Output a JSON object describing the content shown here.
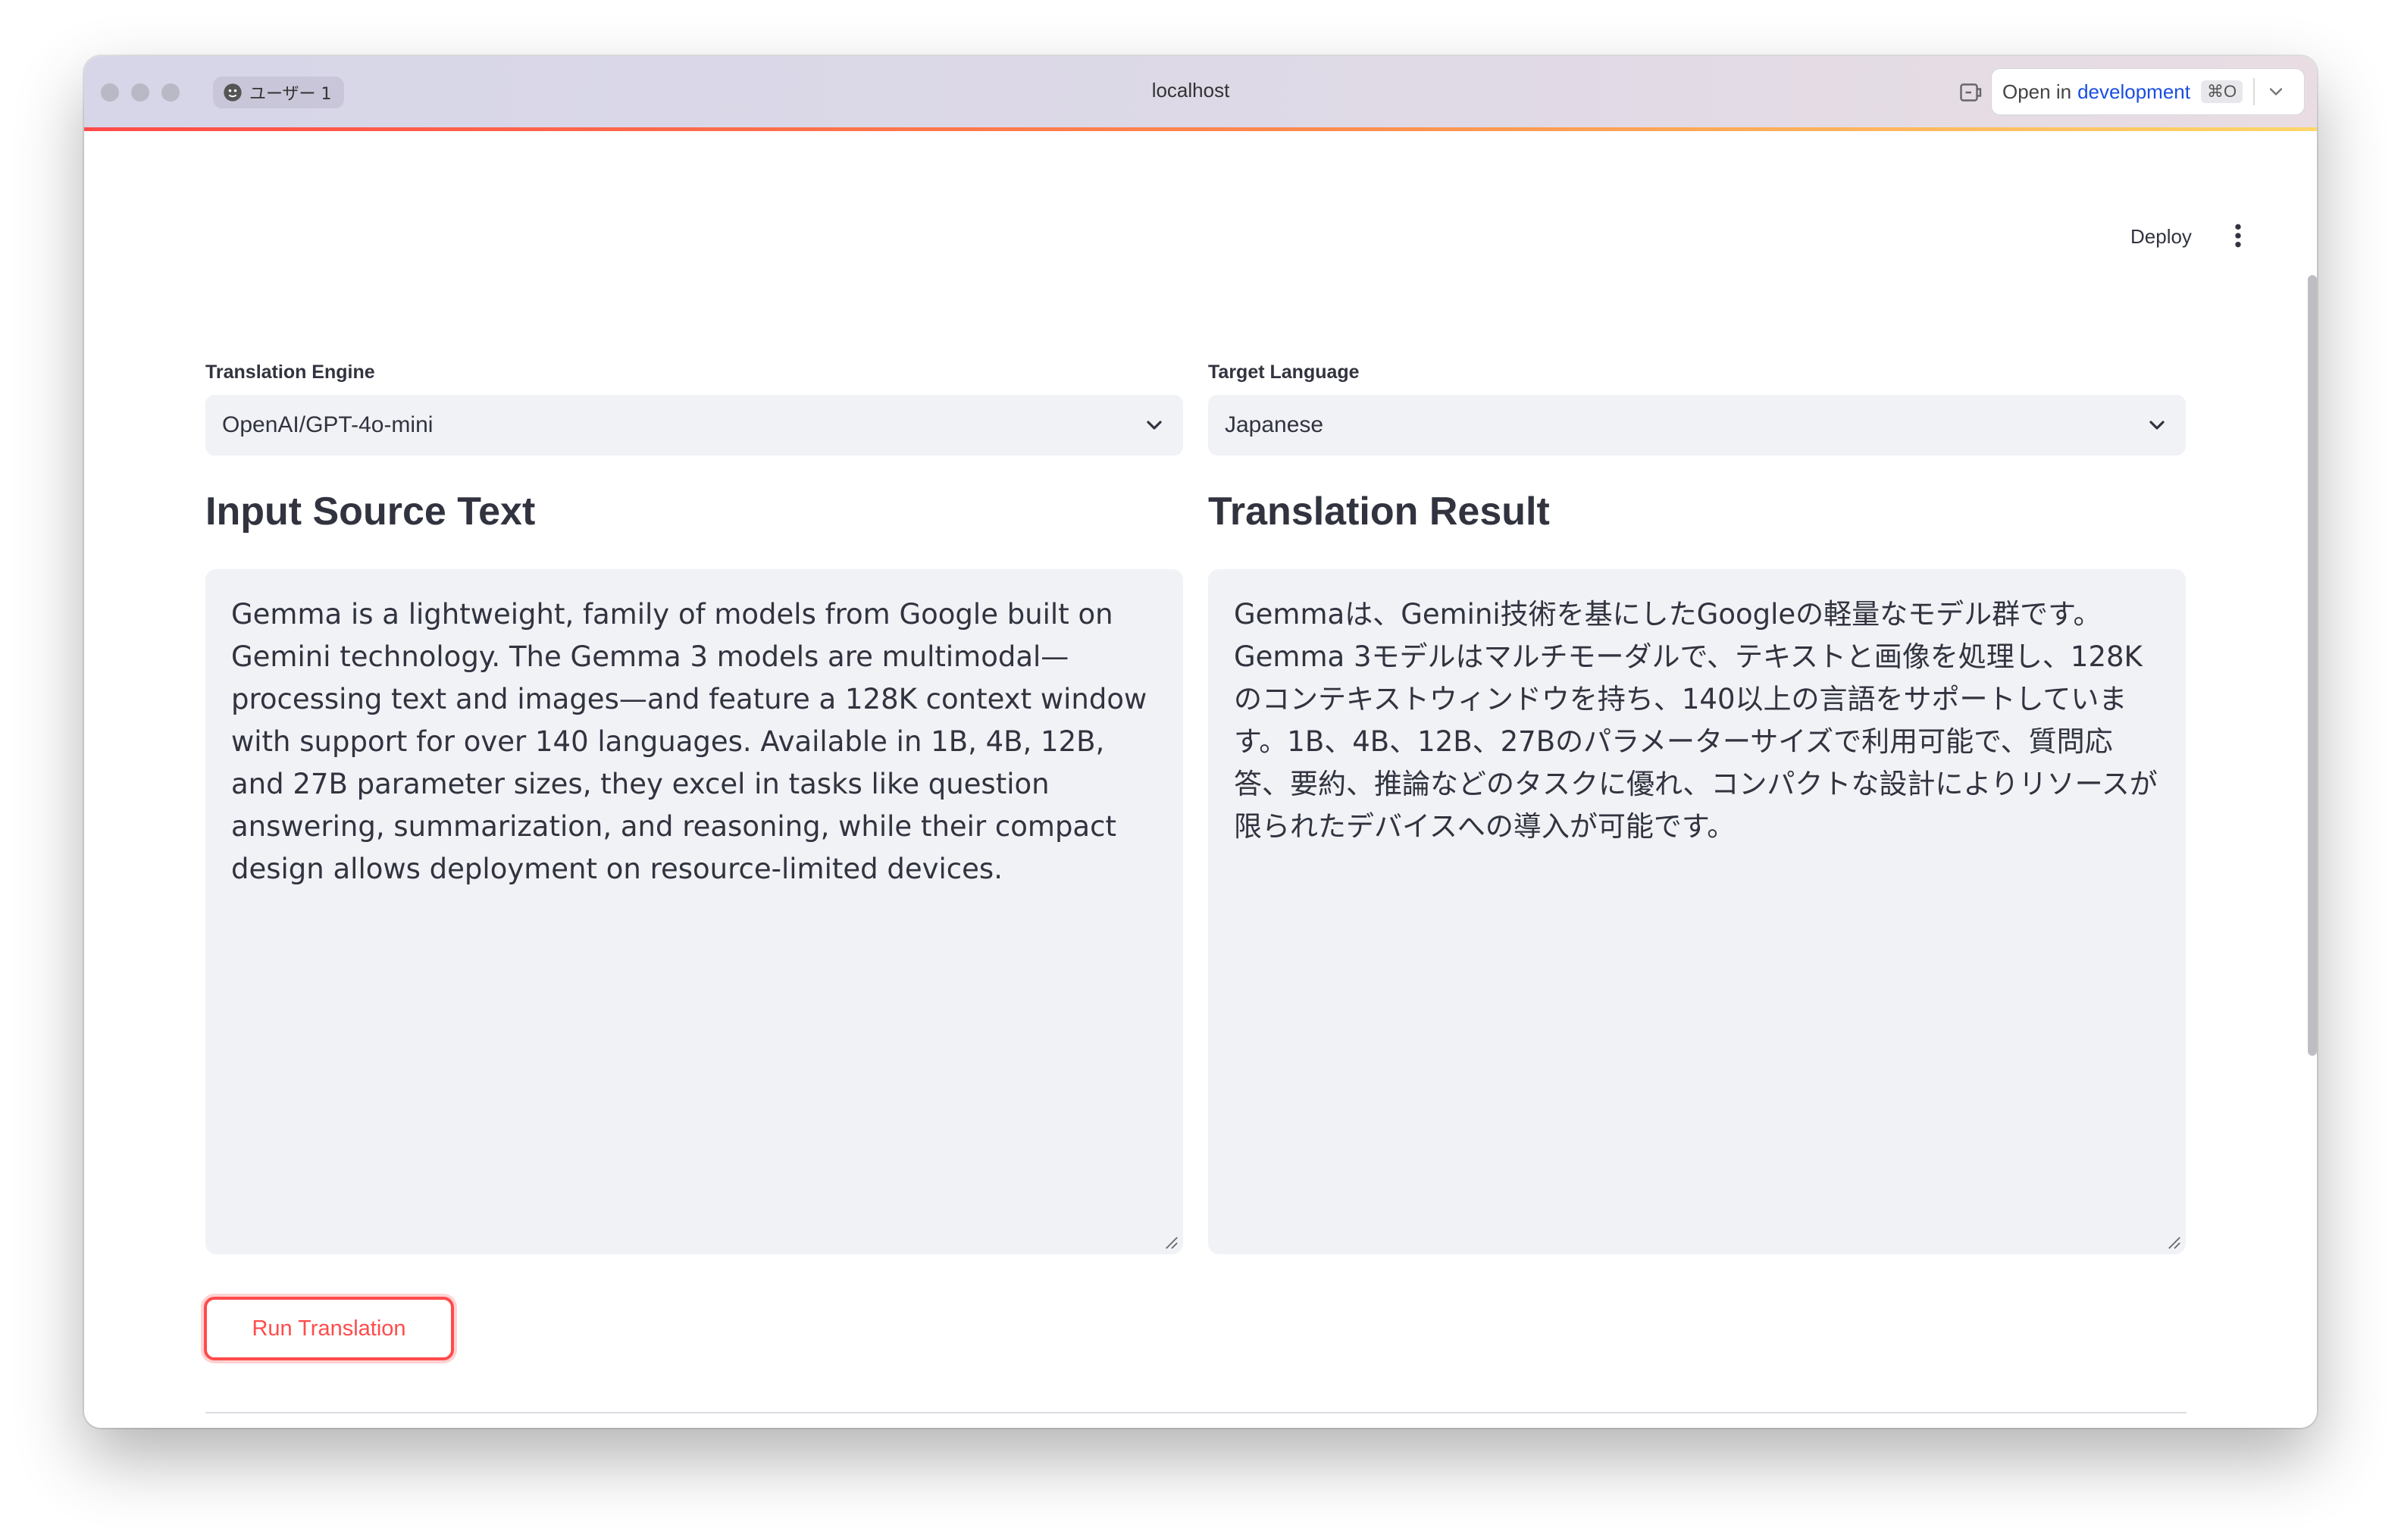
{
  "browser": {
    "profile_label": "ユーザー 1",
    "url": "localhost",
    "open_in": {
      "label": "Open in",
      "environment": "development",
      "shortcut": "⌘O"
    }
  },
  "app": {
    "deploy_label": "Deploy",
    "engine": {
      "label": "Translation Engine",
      "selected": "OpenAI/GPT-4o-mini"
    },
    "target": {
      "label": "Target Language",
      "selected": "Japanese"
    },
    "input": {
      "heading": "Input Source Text",
      "text": "Gemma is a lightweight, family of models from Google built on Gemini technology. The Gemma 3 models are multimodal—processing text and images—and feature a 128K context window with support for over 140 languages. Available in 1B, 4B, 12B, and 27B parameter sizes, they excel in tasks like question answering, summarization, and reasoning, while their compact design allows deployment on resource-limited devices."
    },
    "output": {
      "heading": "Translation Result",
      "text": "Gemmaは、Gemini技術を基にしたGoogleの軽量なモデル群です。Gemma 3モデルはマルチモーダルで、テキストと画像を処理し、128Kのコンテキストウィンドウを持ち、140以上の言語をサポートしています。1B、4B、12B、27Bのパラメーターサイズで利用可能で、質問応答、要約、推論などのタスクに優れ、コンパクトな設計によりリソースが限られたデバイスへの導入が可能です。"
    },
    "run_button": "Run Translation"
  },
  "colors": {
    "accent": "#ff4b4b",
    "field_bg": "#f0f2f6",
    "text": "#31333f",
    "link": "#1a4ee0"
  }
}
